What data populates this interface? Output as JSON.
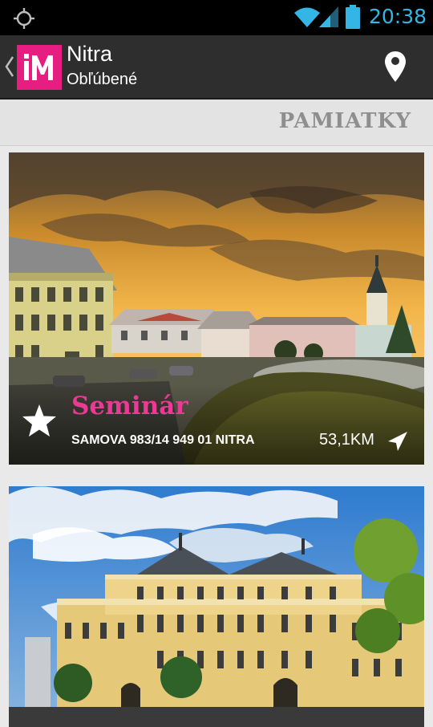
{
  "status_bar": {
    "time": "20:38",
    "icons": [
      "gps-icon",
      "wifi-icon",
      "signal-icon",
      "battery-icon"
    ],
    "time_color": "#33b5e5"
  },
  "action_bar": {
    "logo_text": "iM",
    "title": "Nitra",
    "subtitle": "Obľúbené",
    "logo_color": "#e61e82"
  },
  "section": {
    "label": "PAMIATKY"
  },
  "cards": [
    {
      "name": "Seminár",
      "address": "SAMOVA 983/14 949 01 NITRA",
      "distance": "53,1KM",
      "favorite": true
    },
    {
      "name": "",
      "address": "",
      "distance": ""
    }
  ],
  "colors": {
    "accent": "#e61e82",
    "name_text": "#ea3a95",
    "header_text": "#8e8e8e"
  }
}
